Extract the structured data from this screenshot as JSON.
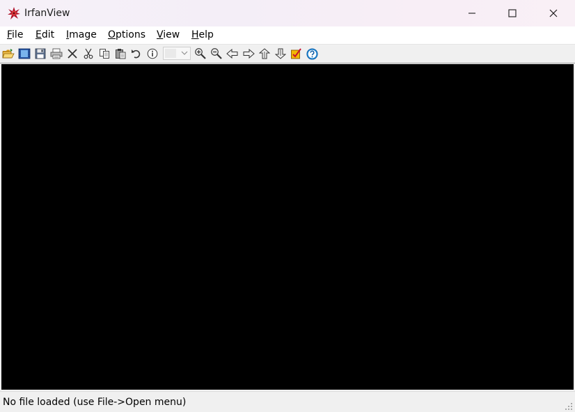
{
  "window": {
    "title": "IrfanView",
    "controls": {
      "minimize_icon": "minimize-icon",
      "maximize_icon": "maximize-icon",
      "close_icon": "close-icon"
    }
  },
  "menu": {
    "items": [
      {
        "accel": "F",
        "rest": "ile"
      },
      {
        "accel": "E",
        "rest": "dit"
      },
      {
        "accel": "I",
        "rest": "mage"
      },
      {
        "accel": "O",
        "rest": "ptions"
      },
      {
        "accel": "V",
        "rest": "iew"
      },
      {
        "accel": "H",
        "rest": "elp"
      }
    ]
  },
  "toolbar": {
    "buttons": [
      {
        "icon": "open-folder-icon"
      },
      {
        "icon": "slideshow-icon"
      },
      {
        "icon": "save-icon"
      },
      {
        "icon": "print-icon"
      },
      {
        "icon": "delete-icon"
      },
      {
        "icon": "cut-icon"
      },
      {
        "icon": "copy-icon"
      },
      {
        "icon": "paste-icon"
      },
      {
        "icon": "undo-icon"
      },
      {
        "icon": "info-icon"
      },
      {
        "icon": "zoom-in-icon"
      },
      {
        "icon": "zoom-out-icon"
      },
      {
        "icon": "previous-icon"
      },
      {
        "icon": "next-icon"
      },
      {
        "icon": "upload-icon"
      },
      {
        "icon": "download-icon"
      },
      {
        "icon": "paint-icon"
      },
      {
        "icon": "help-icon"
      }
    ],
    "zoom_combo_value": ""
  },
  "canvas": {
    "background": "#000000"
  },
  "status": {
    "text": "No file loaded (use File->Open menu)"
  },
  "colors": {
    "canvas": "#000000",
    "help_blue": "#2a8fd9",
    "paint_yellow": "#f2b705",
    "app_icon_red": "#c8102e"
  }
}
